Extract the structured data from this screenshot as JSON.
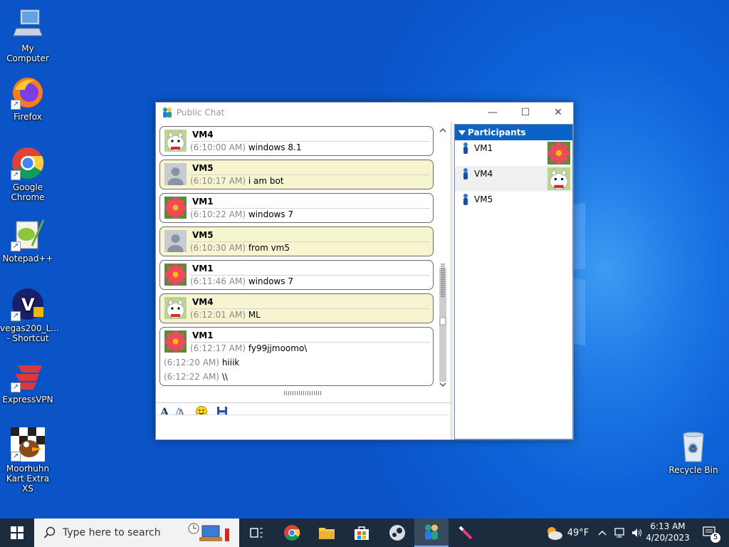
{
  "desktop": {
    "icons": [
      {
        "label": "My Computer"
      },
      {
        "label": "Firefox"
      },
      {
        "label": "Google Chrome"
      },
      {
        "label": "Notepad++"
      },
      {
        "label": "vegas200_L... - Shortcut"
      },
      {
        "label": "ExpressVPN"
      },
      {
        "label": "Moorhuhn Kart Extra XS"
      },
      {
        "label": "Recycle Bin"
      }
    ]
  },
  "window": {
    "title": "Public Chat",
    "minimize_glyph": "—",
    "maximize_glyph": "☐",
    "close_glyph": "✕"
  },
  "chat": {
    "messages": [
      {
        "name": "VM4",
        "time": "(6:10:00 AM)",
        "text": "windows 8.1",
        "avatar": "cat-avatar"
      },
      {
        "name": "VM5",
        "time": "(6:10:17 AM)",
        "text": "i am bot",
        "avatar": "default-avatar"
      },
      {
        "name": "VM1",
        "time": "(6:10:22 AM)",
        "text": "windows 7",
        "avatar": "flower-avatar"
      },
      {
        "name": "VM5",
        "time": "(6:10:30 AM)",
        "text": "from vm5",
        "avatar": "default-avatar"
      },
      {
        "name": "VM1",
        "time": "(6:11:46 AM)",
        "text": "windows 7",
        "avatar": "flower-avatar"
      },
      {
        "name": "VM4",
        "time": "(6:12:01 AM)",
        "text": "ML",
        "avatar": "cat-avatar"
      },
      {
        "name": "VM1",
        "time": "(6:12:17 AM)",
        "text": "fy99jjmoomo\\",
        "avatar": "flower-avatar",
        "extra": [
          {
            "time": "(6:12:20 AM)",
            "text": "hiiik"
          },
          {
            "time": "(6:12:22 AM)",
            "text": "\\\\"
          }
        ]
      }
    ],
    "input_value": ""
  },
  "participants": {
    "header": "Participants",
    "items": [
      {
        "name": "VM1",
        "avatar": "flower-avatar"
      },
      {
        "name": "VM4",
        "avatar": "cat-avatar"
      },
      {
        "name": "VM5",
        "avatar": ""
      }
    ]
  },
  "taskbar": {
    "search_placeholder": "Type here to search",
    "weather": "49°F",
    "time": "6:13 AM",
    "date": "4/20/2023",
    "notification_count": "5"
  },
  "colors": {
    "accent": "#0a64c8",
    "bubble_yellow": "#f6f5d0",
    "taskbar": "#1c2b3d"
  }
}
